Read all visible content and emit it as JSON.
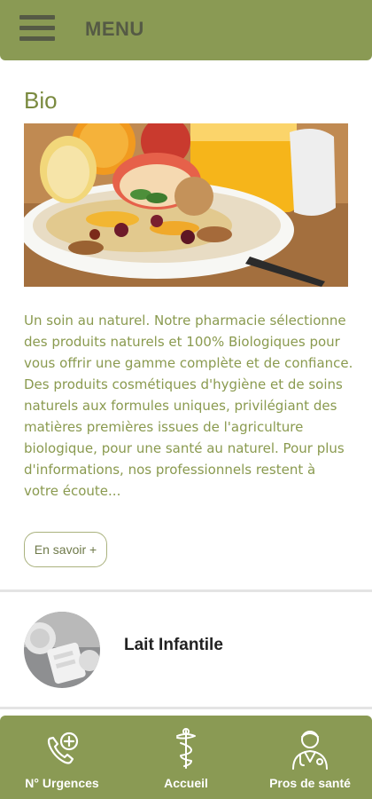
{
  "header": {
    "menu_label": "MENU"
  },
  "bio": {
    "title": "Bio",
    "description": "Un soin au naturel. Notre pharmacie sélectionne des produits naturels et 100% Biologiques pour vous offrir une gamme complète et de confiance. Des produits cosmétiques d'hygiène et de soins naturels aux formules uniques, privilégiant des matières premières issues de l'agriculture biologique, pour une santé au naturel. Pour plus d'informations, nos professionnels restent à votre écoute...",
    "more_label": "En savoir +"
  },
  "items": [
    {
      "label": "Lait Infantile"
    }
  ],
  "bottom_nav": [
    {
      "label": "N° Urgences",
      "icon": "phone-plus-icon"
    },
    {
      "label": "Accueil",
      "icon": "caduceus-icon"
    },
    {
      "label": "Pros de santé",
      "icon": "doctor-icon"
    }
  ],
  "colors": {
    "brand": "#8a9a54",
    "title_green": "#7a8a3f",
    "text_green": "#8a9a4f",
    "icon_dark": "#555a45"
  }
}
